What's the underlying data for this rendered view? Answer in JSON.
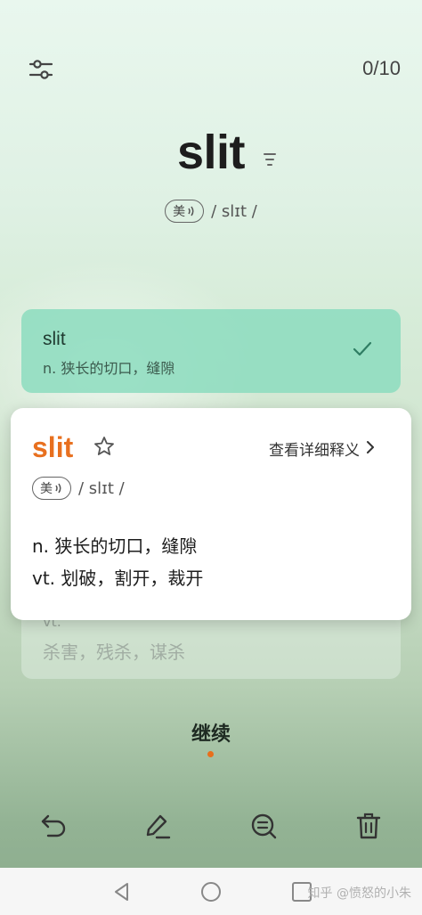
{
  "header": {
    "counter": "0/10",
    "filter_icon": "sliders-icon"
  },
  "word": {
    "text": "slit",
    "level_icon": "level-bars-icon",
    "accent_label": "美",
    "phonetic": "/ slɪt /"
  },
  "options": [
    {
      "word": "slit",
      "definition": "n. 狭长的切口，缝隙",
      "state": "correct",
      "accent": "#8cdcbe"
    },
    {
      "pos": "vt.",
      "definition": "杀害，残杀，谋杀"
    }
  ],
  "card": {
    "word": "slit",
    "word_color": "#e8701f",
    "detail_link": "查看详细释义",
    "accent_label": "美",
    "phonetic": "/ slɪt /",
    "definitions": [
      "n. 狭长的切口，缝隙",
      "vt. 划破，割开，裁开"
    ]
  },
  "continue_label": "继续",
  "toolbar": {
    "icons": [
      "undo-icon",
      "edit-icon",
      "search-note-icon",
      "delete-icon"
    ]
  },
  "navbar": {
    "icons": [
      "back-icon",
      "home-icon",
      "recent-icon"
    ],
    "watermark": "知乎 @愤怒的小朱"
  }
}
